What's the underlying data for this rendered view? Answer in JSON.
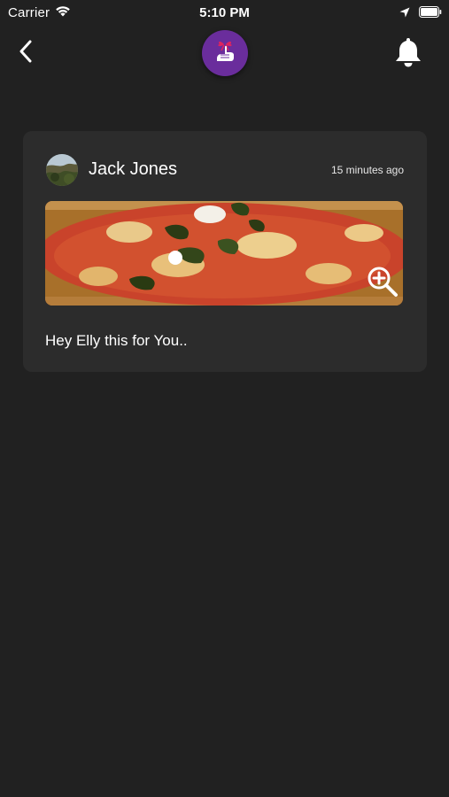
{
  "status_bar": {
    "carrier": "Carrier",
    "time": "5:10 PM",
    "icons": [
      "wifi-icon",
      "location-arrow-icon",
      "battery-icon"
    ]
  },
  "nav": {
    "back_icon": "chevron-left-icon",
    "logo_icon": "hand-with-ribbon-logo",
    "bell_icon": "bell-icon",
    "accent_color": "#6a2d9c"
  },
  "post": {
    "sender_name": "Jack Jones",
    "timestamp": "15 minutes ago",
    "message": "Hey Elly this for You..",
    "image_subject": "pizza",
    "zoom_icon": "zoom-in-icon"
  },
  "colors": {
    "background": "#212121",
    "card": "#2c2c2c",
    "text": "#ffffff"
  }
}
